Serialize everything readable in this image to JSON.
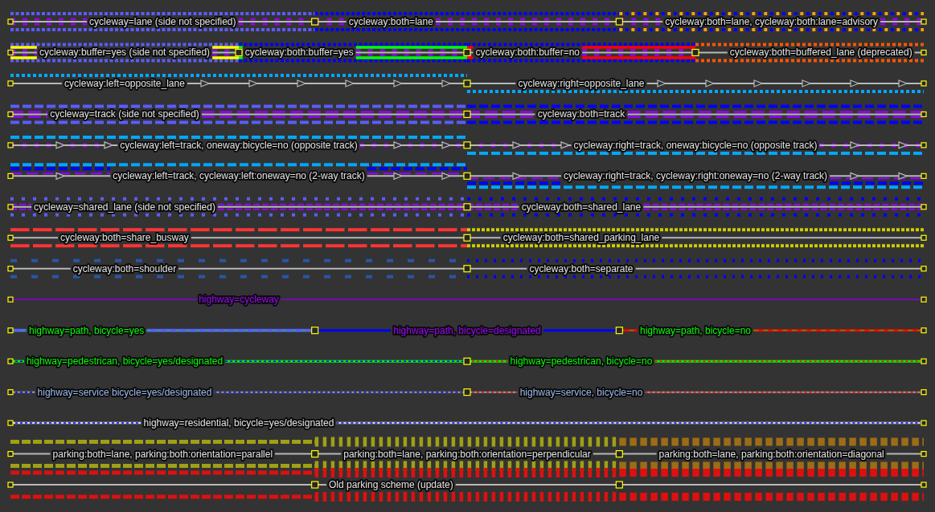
{
  "rows": [
    {
      "ways": [
        {
          "kind": "lane",
          "label": "cycleway=lane (side not specified)"
        },
        {
          "kind": "bothlane",
          "label": "cycleway:both=lane"
        },
        {
          "kind": "advisory",
          "label": "cycleway:both=lane, cycleway:both:lane=advisory"
        }
      ]
    },
    {
      "ways": [
        {
          "kind": "buffer",
          "label": "cycleway:buffer=yes (side not specified)"
        },
        {
          "kind": "bufferyes",
          "label": "cycleway:both:buffer=yes"
        },
        {
          "kind": "bufferno",
          "label": "cycleway:both:buffer=no"
        },
        {
          "kind": "buffered",
          "label": "cycleway:both=buffered_lane (deprecated)"
        }
      ]
    },
    {
      "ways": [
        {
          "kind": "oppositeleft",
          "label": "cycleway:left=opposite_lane"
        },
        {
          "kind": "oppositeright",
          "label": "cycleway:right=opposite_lane"
        }
      ]
    },
    {
      "ways": [
        {
          "kind": "track",
          "label": "cycleway=track (side not specified)"
        },
        {
          "kind": "bothtrack",
          "label": "cycleway:both=track"
        }
      ]
    },
    {
      "ways": [
        {
          "kind": "trackleft",
          "label": "cycleway:left=track, oneway:bicycle=no (opposite track)"
        },
        {
          "kind": "trackright",
          "label": "cycleway:right=track, oneway:bicycle=no (opposite track)"
        }
      ]
    },
    {
      "ways": [
        {
          "kind": "twowayleft",
          "label": "cycleway:left=track, cycleway:left:oneway=no (2-way track)"
        },
        {
          "kind": "twowayright",
          "label": "cycleway:right=track, cycleway:right:oneway=no (2-way track)"
        }
      ]
    },
    {
      "ways": [
        {
          "kind": "shared",
          "label": "cycleway=shared_lane (side not specified)"
        },
        {
          "kind": "bothshared",
          "label": "cycleway:both=shared_lane"
        }
      ]
    },
    {
      "ways": [
        {
          "kind": "busway",
          "label": "cycleway:both=share_busway"
        },
        {
          "kind": "parkinglane",
          "label": "cycleway:both=shared_parking_lane"
        }
      ]
    },
    {
      "ways": [
        {
          "kind": "shoulder",
          "label": "cycleway:both=shoulder"
        },
        {
          "kind": "separate",
          "label": "cycleway:both=separate"
        }
      ]
    },
    {
      "ways": [
        {
          "kind": "cycleway",
          "label": "highway=cycleway"
        }
      ]
    },
    {
      "ways": [
        {
          "kind": "pathyes",
          "label": "highway=path, bicycle=yes"
        },
        {
          "kind": "pathdesignated",
          "label": "highway=path, bicycle=designated"
        },
        {
          "kind": "pathno",
          "label": "highway=path, bicycle=no"
        }
      ]
    },
    {
      "ways": [
        {
          "kind": "pedestrianyes",
          "label": "highway=pedestrican, bicycle=yes/designated"
        },
        {
          "kind": "pedestrianno",
          "label": "highway=pedestrican, bicycle=no"
        }
      ]
    },
    {
      "ways": [
        {
          "kind": "serviceyes",
          "label": "highway=service bicycle=yes/designated"
        },
        {
          "kind": "serviceno",
          "label": "highway=service, bicycle=no"
        }
      ]
    },
    {
      "ways": [
        {
          "kind": "residential",
          "label": "highway=residential, bicycle=yes/designated"
        }
      ]
    },
    {
      "ways": [
        {
          "kind": "parallel",
          "label": "parking:both=lane, parking:both:orientation=parallel"
        },
        {
          "kind": "perpendicular",
          "label": "parking:both=lane, parking:both:orientation=perpendicular"
        },
        {
          "kind": "diagonal",
          "label": "parking:both=lane, parking:both:orientation=diagonal"
        }
      ]
    },
    {
      "ways": [
        {
          "kind": "oldparallel"
        },
        {
          "kind": "oldperpendicular",
          "label": "Old parking scheme (update)"
        },
        {
          "kind": "olddiagonal"
        }
      ]
    }
  ]
}
